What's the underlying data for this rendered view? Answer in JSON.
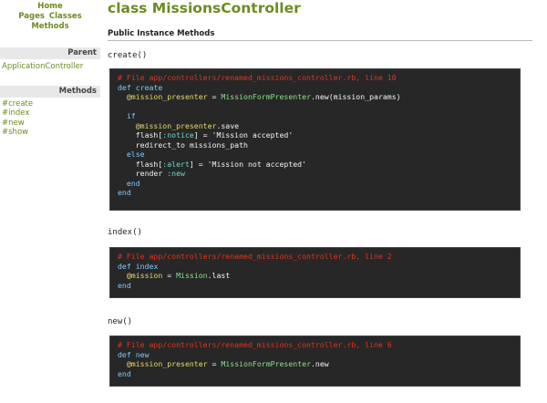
{
  "nav": {
    "home": "Home",
    "pages": "Pages",
    "classes": "Classes",
    "methods": "Methods"
  },
  "sidebar": {
    "parent_heading": "Parent",
    "parent_link": "ApplicationController",
    "methods_heading": "Methods",
    "methods": [
      "#create",
      "#index",
      "#new",
      "#show"
    ]
  },
  "main": {
    "title": "class MissionsController",
    "section_title": "Public Instance Methods",
    "methods": [
      {
        "signature": "create()",
        "comment": "# File app/controllers/renamed_missions_controller.rb, line 10"
      },
      {
        "signature": "index()",
        "comment": "# File app/controllers/renamed_missions_controller.rb, line 2"
      },
      {
        "signature": "new()",
        "comment": "# File app/controllers/renamed_missions_controller.rb, line 6"
      }
    ]
  },
  "code_colors": {
    "background": "#272727",
    "comment": "#e0341e",
    "keyword": "#7ec9ff",
    "ivar": "#e6d96a",
    "constant": "#8be08a",
    "link_green": "#6c8c22"
  }
}
